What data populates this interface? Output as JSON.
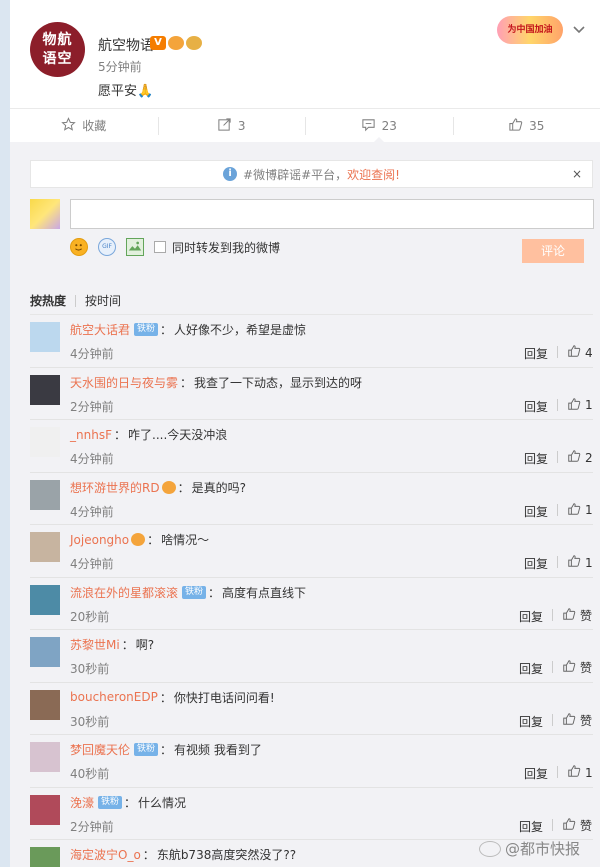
{
  "post": {
    "avatar_text": "物航\n语空",
    "author": "航空物语",
    "badges": [
      "V",
      "",
      ""
    ],
    "time": "5分钟前",
    "text": "愿平安🙏",
    "cheer_banner": "为中国加油"
  },
  "actions": [
    {
      "icon": "star-icon",
      "label": "收藏"
    },
    {
      "icon": "repost-icon",
      "label": "3"
    },
    {
      "icon": "comment-icon",
      "label": "23"
    },
    {
      "icon": "thumbs-up-icon",
      "label": "35"
    }
  ],
  "notice": {
    "icon": "i",
    "prefix": "#微博辟谣#平台，",
    "link": "欢迎查阅!",
    "close": "×"
  },
  "composer": {
    "input_value": "",
    "repost_label": "同时转发到我的微博",
    "submit_label": "评论",
    "gif_label": "GIF"
  },
  "sort": {
    "hot": "按热度",
    "time": "按时间"
  },
  "comments": [
    {
      "user": "航空大话君",
      "fan": "铁粉",
      "medal": false,
      "text": "人好像不少，希望是虚惊",
      "time": "4分钟前",
      "reply": "回复",
      "likes": "4",
      "avatar_color": "#bcd8ee"
    },
    {
      "user": "天水围的日与夜与雾",
      "fan": "",
      "medal": false,
      "text": "我查了一下动态，显示到达的呀",
      "time": "2分钟前",
      "reply": "回复",
      "likes": "1",
      "avatar_color": "#3a3a42"
    },
    {
      "user": "_nnhsF",
      "fan": "",
      "medal": false,
      "text": "咋了....今天没冲浪",
      "time": "4分钟前",
      "reply": "回复",
      "likes": "2",
      "avatar_color": "#f0f0f0"
    },
    {
      "user": "想环游世界的RD",
      "fan": "",
      "medal": true,
      "text": "是真的吗?",
      "time": "4分钟前",
      "reply": "回复",
      "likes": "1",
      "avatar_color": "#9aa3a8"
    },
    {
      "user": "Jojeongho",
      "fan": "",
      "medal": true,
      "text": "啥情况～",
      "time": "4分钟前",
      "reply": "回复",
      "likes": "1",
      "avatar_color": "#c7b4a0"
    },
    {
      "user": "流浪在外的星都滚滚",
      "fan": "铁粉",
      "medal": false,
      "text": "高度有点直线下",
      "time": "20秒前",
      "reply": "回复",
      "likes": "赞",
      "avatar_color": "#4d8ba6"
    },
    {
      "user": "苏黎世Mi",
      "fan": "",
      "medal": false,
      "text": "啊?",
      "time": "30秒前",
      "reply": "回复",
      "likes": "赞",
      "avatar_color": "#7fa4c4"
    },
    {
      "user": "boucheronEDP",
      "fan": "",
      "medal": false,
      "text": "你快打电话问问看!",
      "time": "30秒前",
      "reply": "回复",
      "likes": "赞",
      "avatar_color": "#8a6a55"
    },
    {
      "user": "梦回魔天伦",
      "fan": "铁粉",
      "medal": false,
      "text": "有视频 我看到了",
      "time": "40秒前",
      "reply": "回复",
      "likes": "1",
      "avatar_color": "#d7c3d0"
    },
    {
      "user": "浼濠",
      "fan": "铁粉",
      "medal": false,
      "text": "什么情况",
      "time": "2分钟前",
      "reply": "回复",
      "likes": "赞",
      "avatar_color": "#b04a5a"
    },
    {
      "user": "海定波宁O_o",
      "fan": "",
      "medal": false,
      "text": "东航b738高度突然没了??",
      "time": "",
      "reply": "",
      "likes": "",
      "avatar_color": "#6a9a5a"
    }
  ],
  "watermark": "@都市快报"
}
